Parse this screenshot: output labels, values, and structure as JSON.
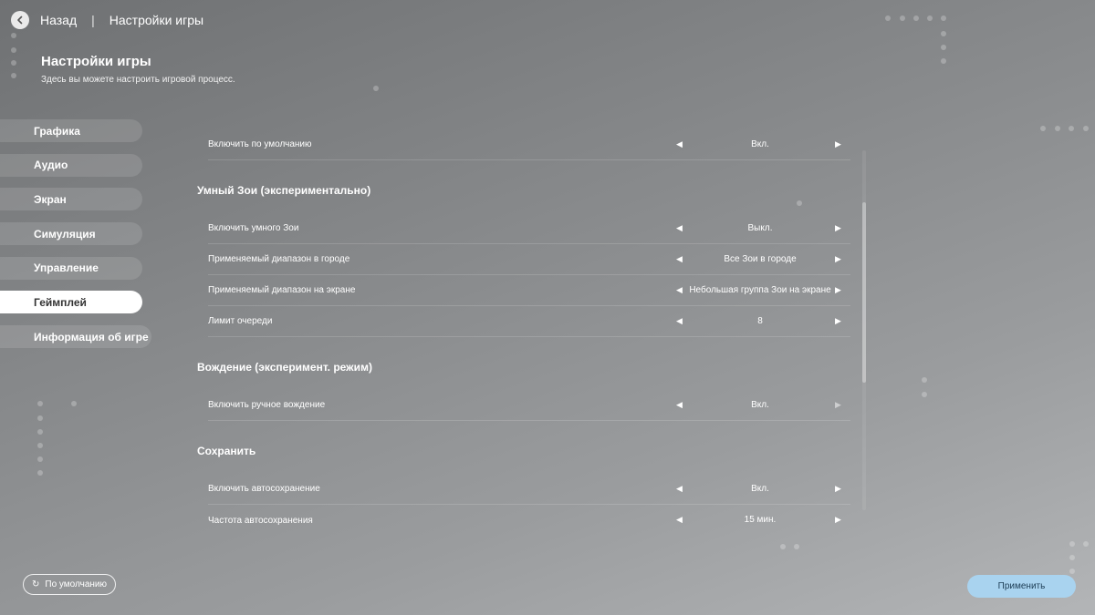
{
  "header": {
    "back_label": "Назад",
    "separator": "|",
    "breadcrumb": "Настройки игры"
  },
  "page": {
    "title": "Настройки игры",
    "subtitle": "Здесь вы можете настроить игровой процесс."
  },
  "sidebar": {
    "items": [
      {
        "label": "Графика",
        "active": false
      },
      {
        "label": "Аудио",
        "active": false
      },
      {
        "label": "Экран",
        "active": false
      },
      {
        "label": "Симуляция",
        "active": false
      },
      {
        "label": "Управление",
        "active": false
      },
      {
        "label": "Геймплей",
        "active": true
      },
      {
        "label": "Информация об игре",
        "active": false
      }
    ]
  },
  "settings": {
    "top_row": {
      "label": "Включить по умолчанию",
      "value": "Вкл."
    },
    "smart_zoe": {
      "title": "Умный Зои (экспериментально)",
      "rows": [
        {
          "label": "Включить умного Зои",
          "value": "Выкл."
        },
        {
          "label": "Применяемый диапазон в городе",
          "value": "Все Зои в городе"
        },
        {
          "label": "Применяемый диапазон на экране",
          "value": "Небольшая группа Зои на экране"
        },
        {
          "label": "Лимит очереди",
          "value": "8"
        }
      ]
    },
    "driving": {
      "title": "Вождение (эксперимент. режим)",
      "rows": [
        {
          "label": "Включить ручное вождение",
          "value": "Вкл."
        }
      ]
    },
    "save": {
      "title": "Сохранить",
      "rows": [
        {
          "label": "Включить автосохранение",
          "value": "Вкл."
        },
        {
          "label": "Частота автосохранения",
          "value": "15 мин."
        }
      ]
    }
  },
  "footer": {
    "reset_label": "По умолчанию",
    "apply_label": "Применить"
  },
  "icons": {
    "back": "chevron-left-icon",
    "reset": "refresh-icon",
    "left": "arrow-left-icon",
    "right": "arrow-right-icon"
  }
}
